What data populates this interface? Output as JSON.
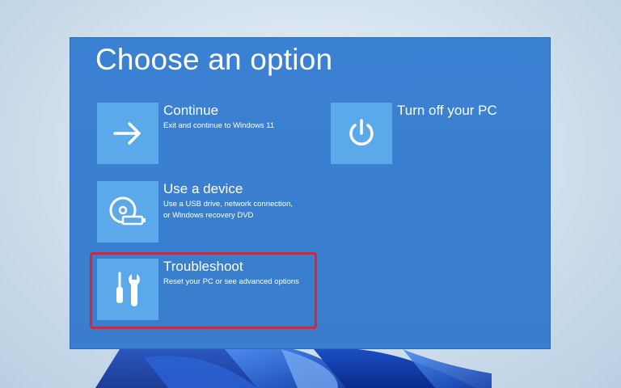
{
  "title": "Choose an option",
  "options": [
    {
      "label": "Continue",
      "description": "Exit and continue to Windows 11",
      "icon": "arrow-right-icon"
    },
    {
      "label": "Turn off your PC",
      "description": "",
      "icon": "power-icon"
    },
    {
      "label": "Use a device",
      "description": "Use a USB drive, network connection,\nor Windows recovery DVD",
      "icon": "disc-usb-icon"
    },
    {
      "label": "Troubleshoot",
      "description": "Reset your PC or see advanced options",
      "icon": "screwdriver-wrench-icon"
    }
  ],
  "colors": {
    "panel": "#3a7fd0",
    "tile": "#5ba9ea",
    "highlight": "#e8202a"
  }
}
